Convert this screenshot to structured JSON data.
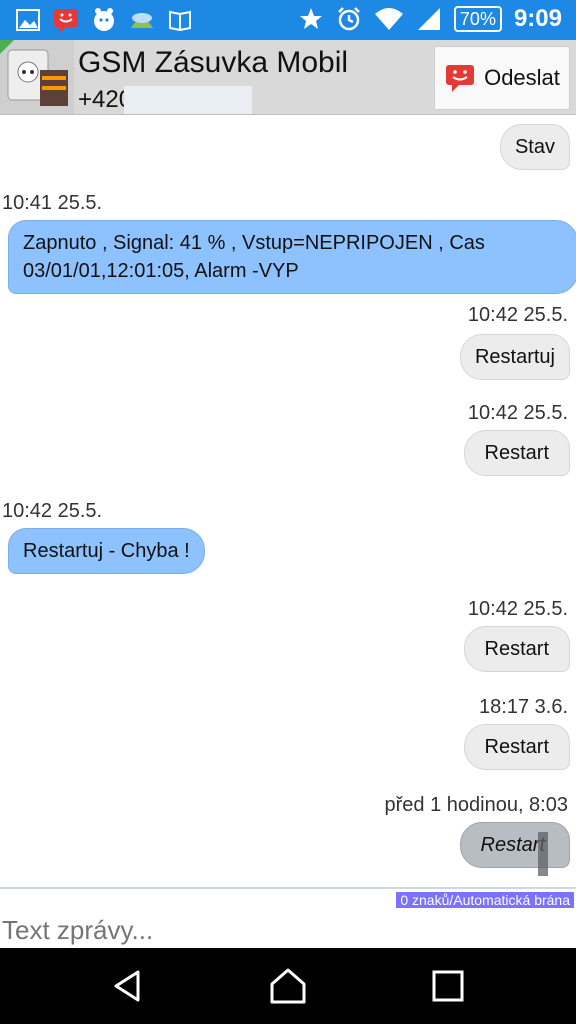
{
  "status_bar": {
    "time": "9:09",
    "battery": "70%"
  },
  "header": {
    "contact_name": "GSM Zásuvka  Mobil",
    "contact_number": "+420",
    "send_label": "Odeslat"
  },
  "messages": [
    {
      "text": "Stav"
    },
    {
      "time": "10:41 25.5.",
      "text": "Zapnuto , Signal: 41 % , Vstup=NEPRIPOJEN , Cas 03/01/01,12:01:05, Alarm -VYP"
    },
    {
      "time": "10:42 25.5.",
      "text": "Restartuj"
    },
    {
      "time": "10:42 25.5.",
      "text": "Restart"
    },
    {
      "time": "10:42 25.5.",
      "text": "Restartuj - Chyba !"
    },
    {
      "time": "10:42 25.5.",
      "text": "Restart"
    },
    {
      "time": "18:17 3.6.",
      "text": "Restart"
    },
    {
      "time": "před 1 hodinou, 8:03",
      "text": "Restart"
    }
  ],
  "composer": {
    "counter": "0 znaků/Automatická brána",
    "placeholder": "Text zprávy..."
  },
  "colors": {
    "status_bar": "#1e88e5",
    "incoming_bubble": "#8ec2ff",
    "outgoing_bubble": "#ececec",
    "pending_bubble": "#b8bdc3",
    "counter_bg": "#7b72ff"
  }
}
